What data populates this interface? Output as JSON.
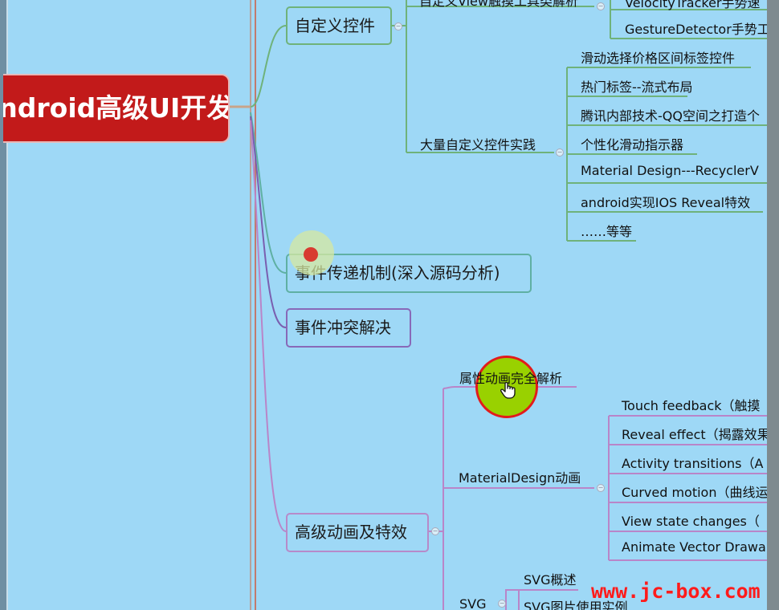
{
  "mindmap": {
    "root": "android高级UI开发",
    "branches": {
      "custom_widgets": {
        "label": "自定义控件",
        "sub_top": "自定义View触摸工具类解析",
        "sub_top_children": [
          "VelocityTracker手势速",
          "GestureDetector手势工"
        ],
        "practice": {
          "label": "大量自定义控件实践",
          "items": [
            "滑动选择价格区间标签控件",
            "热门标签--流式布局",
            "腾讯内部技术-QQ空间之打造个",
            "个性化滑动指示器",
            "Material Design---RecyclerV",
            "android实现IOS Reveal特效",
            "……等等"
          ]
        }
      },
      "event_dispatch": {
        "label": "事件传递机制(深入源码分析)"
      },
      "event_conflict": {
        "label": "事件冲突解决"
      },
      "animation": {
        "label": "高级动画及特效",
        "property_animation": "属性动画完全解析",
        "material_design": {
          "label": "MaterialDesign动画",
          "items": [
            "Touch feedback（触摸",
            "Reveal effect（揭露效果",
            "Activity transitions（A",
            "Curved motion（曲线运",
            "View state changes（",
            "Animate Vector Drawa"
          ]
        },
        "svg": {
          "label": "SVG",
          "items": [
            "SVG概述",
            "SVG图片使用实例"
          ]
        }
      }
    }
  },
  "watermark": "www.jc-box.com",
  "icons": {
    "cursor": "hand-pointer-icon",
    "collapse": "collapse-toggle-icon"
  },
  "colors": {
    "background": "#9ed8f6",
    "root_fill": "#c21a1a",
    "cursor_ring": "#99d100",
    "watermark": "#ff1b1b"
  }
}
